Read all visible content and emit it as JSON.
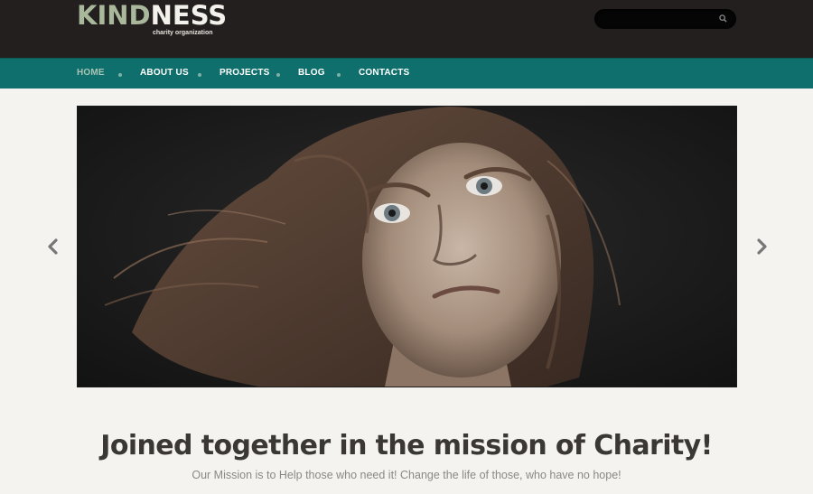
{
  "brand": {
    "name_part1": "KIND",
    "name_part2": "NESS",
    "tagline": "charity organization"
  },
  "search": {
    "placeholder": "",
    "icon": "search-icon"
  },
  "nav": {
    "items": [
      {
        "label": "HOME",
        "active": true
      },
      {
        "label": "ABOUT US",
        "active": false
      },
      {
        "label": "PROJECTS",
        "active": false
      },
      {
        "label": "BLOG",
        "active": false
      },
      {
        "label": "CONTACTS",
        "active": false
      }
    ]
  },
  "slider": {
    "prev_icon": "chevron-left-icon",
    "next_icon": "chevron-right-icon"
  },
  "hero": {
    "headline": "Joined together in the mission of Charity!",
    "subline": "Our Mission is to Help those who need it! Change the life of those, who have no hope!"
  },
  "colors": {
    "header_bg": "#221f1e",
    "nav_bg": "#0f6f6c",
    "logo_accent": "#a9b79b",
    "page_bg": "#f5f3ef",
    "headline": "#3a3735"
  }
}
